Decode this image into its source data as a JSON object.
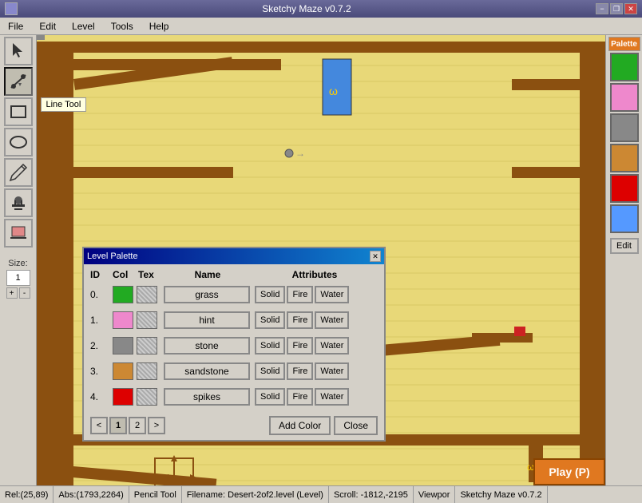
{
  "app": {
    "title": "Sketchy Maze v0.7.2"
  },
  "titlebar": {
    "title": "Sketchy Maze v0.7.2",
    "minimize": "−",
    "maximize": "□",
    "restore": "❐",
    "close": "✕"
  },
  "menubar": {
    "items": [
      "File",
      "Edit",
      "Level",
      "Tools",
      "Help"
    ]
  },
  "toolbar": {
    "tools": [
      {
        "name": "pointer-tool",
        "label": "Pointer"
      },
      {
        "name": "line-tool",
        "label": "Line Tool"
      },
      {
        "name": "rect-tool",
        "label": "Rectangle"
      },
      {
        "name": "ellipse-tool",
        "label": "Ellipse"
      },
      {
        "name": "pencil-tool",
        "label": "Pencil"
      },
      {
        "name": "stamp-tool",
        "label": "Stamp"
      },
      {
        "name": "erase-tool",
        "label": "Eraser"
      }
    ],
    "tooltip": "Line Tool",
    "size_label": "Size:",
    "size_value": "1",
    "size_plus": "+",
    "size_minus": "-"
  },
  "palette_panel": {
    "header": "Palette",
    "colors": [
      "#22aa22",
      "#ee88cc",
      "#888888",
      "#cc8833",
      "#dd0000",
      "#5599ff"
    ],
    "edit_label": "Edit"
  },
  "dialog": {
    "title": "Level Palette",
    "close": "✕",
    "columns": {
      "id": "ID",
      "col": "Col",
      "tex": "Tex",
      "name": "Name",
      "attributes": "Attributes"
    },
    "rows": [
      {
        "id": "0.",
        "color": "#22aa22",
        "name": "grass",
        "solid": "Solid",
        "fire": "Fire",
        "water": "Water"
      },
      {
        "id": "1.",
        "color": "#ee88cc",
        "name": "hint",
        "solid": "Solid",
        "fire": "Fire",
        "water": "Water"
      },
      {
        "id": "2.",
        "color": "#888888",
        "name": "stone",
        "solid": "Solid",
        "fire": "Fire",
        "water": "Water"
      },
      {
        "id": "3.",
        "color": "#cc8833",
        "name": "sandstone",
        "solid": "Solid",
        "fire": "Fire",
        "water": "Water"
      },
      {
        "id": "4.",
        "color": "#dd0000",
        "name": "spikes",
        "solid": "Solid",
        "fire": "Fire",
        "water": "Water"
      }
    ],
    "pages": [
      "<",
      "1",
      "2",
      ">"
    ],
    "add_color": "Add Color",
    "close_btn": "Close"
  },
  "statusbar": {
    "rel": "Rel:(25,89)",
    "abs": "Abs:(1793,2264)",
    "tool": "Pencil Tool",
    "filename": "Filename: Desert-2of2.level (Level)",
    "scroll": "Scroll: -1812,-2195",
    "viewport": "Viewpor",
    "version": "Sketchy Maze v0.7.2"
  },
  "play_button": {
    "label": "Play (P)"
  }
}
